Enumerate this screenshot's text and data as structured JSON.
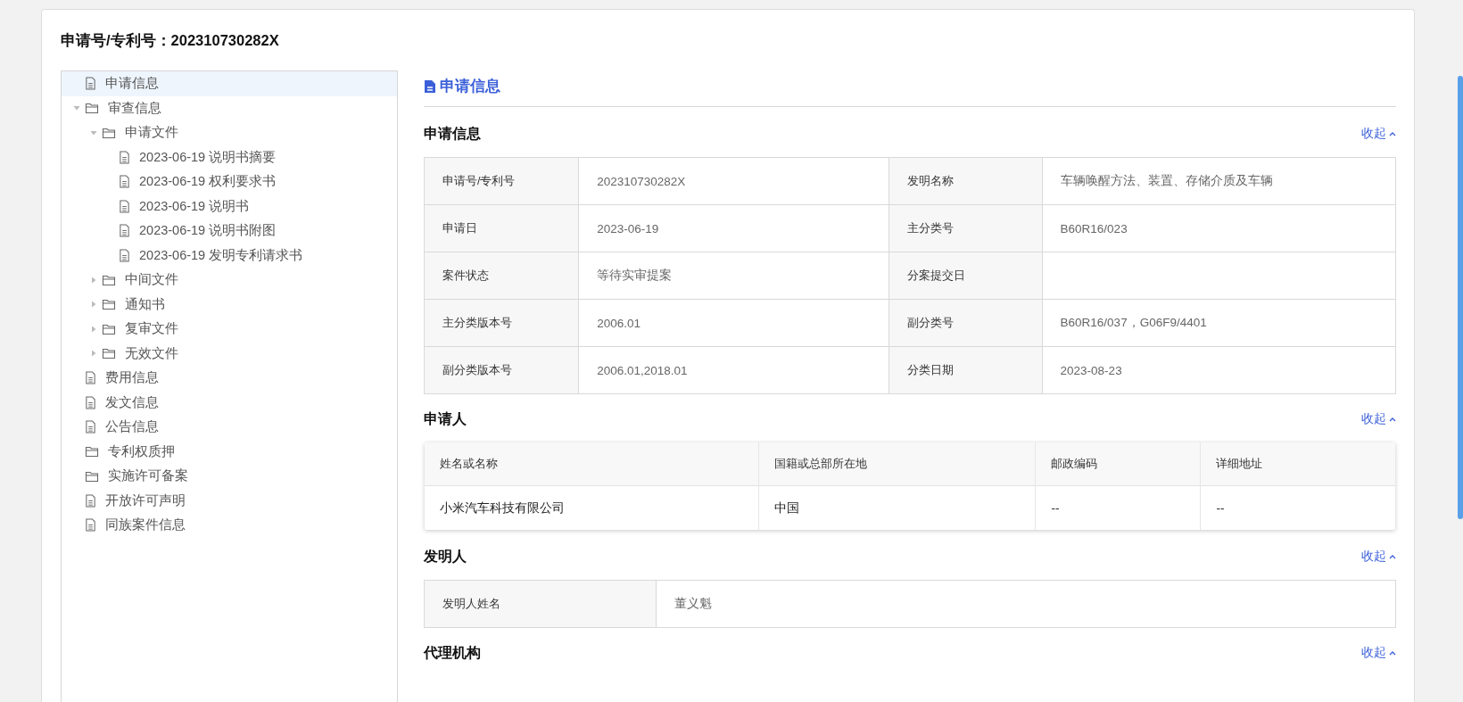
{
  "page_title": "申请号/专利号：202310730282X",
  "tree": {
    "items": [
      {
        "label": "申请信息",
        "kind": "document",
        "selected": true
      },
      {
        "label": "审查信息",
        "kind": "folder",
        "selected": false,
        "expanded": true,
        "children": [
          {
            "label": "申请文件",
            "kind": "folder",
            "selected": false,
            "expanded": true,
            "children": [
              {
                "label": "2023-06-19 说明书摘要",
                "kind": "document",
                "selected": false
              },
              {
                "label": "2023-06-19 权利要求书",
                "kind": "document",
                "selected": false
              },
              {
                "label": "2023-06-19 说明书",
                "kind": "document",
                "selected": false
              },
              {
                "label": "2023-06-19 说明书附图",
                "kind": "document",
                "selected": false
              },
              {
                "label": "2023-06-19 发明专利请求书",
                "kind": "document",
                "selected": false
              }
            ]
          },
          {
            "label": "中间文件",
            "kind": "folder",
            "selected": false,
            "expanded": false
          },
          {
            "label": "通知书",
            "kind": "folder",
            "selected": false,
            "expanded": false
          },
          {
            "label": "复审文件",
            "kind": "folder",
            "selected": false,
            "expanded": false
          },
          {
            "label": "无效文件",
            "kind": "folder",
            "selected": false,
            "expanded": false
          }
        ]
      },
      {
        "label": "费用信息",
        "kind": "document",
        "selected": false
      },
      {
        "label": "发文信息",
        "kind": "document",
        "selected": false
      },
      {
        "label": "公告信息",
        "kind": "document",
        "selected": false
      },
      {
        "label": "专利权质押",
        "kind": "folder",
        "selected": false
      },
      {
        "label": "实施许可备案",
        "kind": "folder",
        "selected": false
      },
      {
        "label": "开放许可声明",
        "kind": "document",
        "selected": false
      },
      {
        "label": "同族案件信息",
        "kind": "document",
        "selected": false
      }
    ]
  },
  "content": {
    "heading": "申请信息",
    "sections": [
      {
        "title": "申请信息",
        "toggle": "收起",
        "kind": "fields",
        "rows": [
          [
            {
              "label": "申请号/专利号",
              "value": "202310730282X"
            },
            {
              "label": "发明名称",
              "value": "车辆唤醒方法、装置、存储介质及车辆"
            }
          ],
          [
            {
              "label": "申请日",
              "value": "2023-06-19"
            },
            {
              "label": "主分类号",
              "value": "B60R16/023"
            }
          ],
          [
            {
              "label": "案件状态",
              "value": "等待实审提案"
            },
            {
              "label": "分案提交日"
            }
          ],
          [
            {
              "label": "主分类版本号",
              "value": "2006.01"
            },
            {
              "label": "副分类号",
              "value": "B60R16/037，G06F9/4401"
            }
          ],
          [
            {
              "label": "副分类版本号",
              "value": "2006.01,2018.01"
            },
            {
              "label": "分类日期",
              "value": "2023-08-23"
            }
          ]
        ]
      },
      {
        "title": "申请人",
        "toggle": "收起",
        "kind": "table",
        "columns": [
          "姓名或名称",
          "国籍或总部所在地",
          "邮政编码",
          "详细地址"
        ],
        "rows": [
          [
            "小米汽车科技有限公司",
            "中国",
            "--",
            "--"
          ]
        ]
      },
      {
        "title": "发明人",
        "toggle": "收起",
        "kind": "fields",
        "rows": [
          [
            {
              "label": "发明人姓名",
              "value": "董义魁"
            }
          ]
        ]
      },
      {
        "title": "代理机构",
        "toggle": "收起",
        "kind": "none"
      }
    ]
  }
}
